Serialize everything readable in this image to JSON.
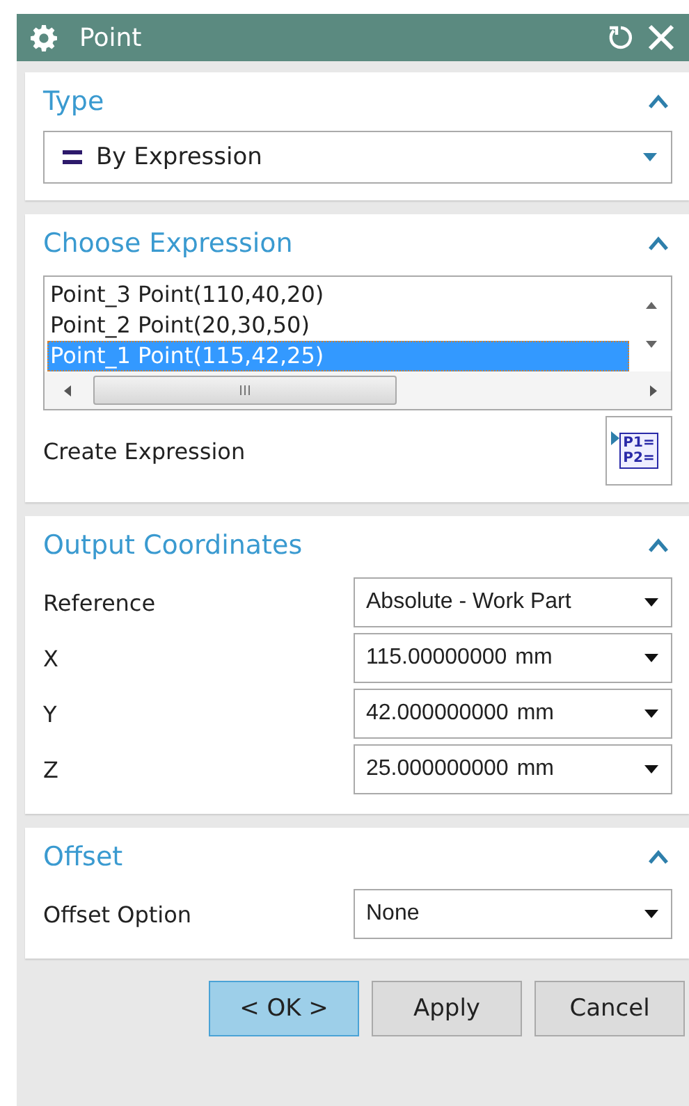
{
  "window": {
    "title": "Point"
  },
  "type_section": {
    "title": "Type",
    "expanded": true,
    "value": "By Expression"
  },
  "expression_section": {
    "title": "Choose Expression",
    "expanded": true,
    "items": [
      {
        "label": "Point_3 Point(110,40,20)",
        "selected": false
      },
      {
        "label": "Point_2 Point(20,30,50)",
        "selected": false
      },
      {
        "label": "Point_1 Point(115,42,25)",
        "selected": true
      }
    ],
    "create_label": "Create Expression",
    "create_icon_lines": [
      "P1=",
      "P2="
    ]
  },
  "output_section": {
    "title": "Output Coordinates",
    "expanded": true,
    "rows": [
      {
        "label": "Reference",
        "value": "Absolute - Work Part"
      },
      {
        "label": "X",
        "value": "115.00000000",
        "unit": "mm"
      },
      {
        "label": "Y",
        "value": "42.000000000",
        "unit": "mm"
      },
      {
        "label": "Z",
        "value": "25.000000000",
        "unit": "mm"
      }
    ]
  },
  "offset_section": {
    "title": "Offset",
    "expanded": true,
    "rows": [
      {
        "label": "Offset Option",
        "value": "None"
      }
    ]
  },
  "buttons": [
    {
      "label": "< OK >",
      "default": true
    },
    {
      "label": "Apply",
      "default": false
    },
    {
      "label": "Cancel",
      "default": false
    }
  ]
}
